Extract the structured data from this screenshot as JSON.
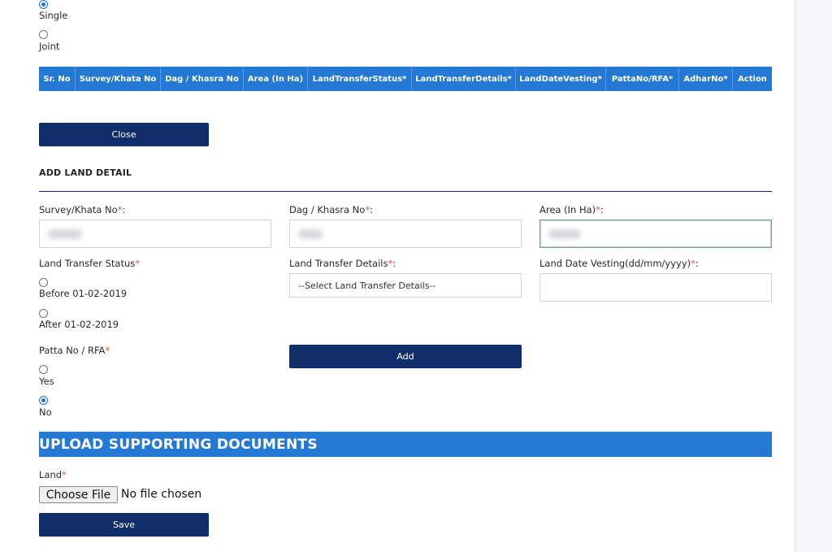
{
  "ownership": {
    "options": [
      {
        "label": "Single",
        "checked": true
      },
      {
        "label": "Joint",
        "checked": false
      }
    ]
  },
  "table": {
    "columns": [
      "Sr. No",
      "Survey/Khata No",
      "Dag / Khasra No",
      "Area (In Ha)",
      "LandTransferStatus*",
      "LandTransferDetails*",
      "LandDateVesting*",
      "PattaNo/RFA*",
      "AdharNo*",
      "Action"
    ]
  },
  "close_button": "Close",
  "add_land_detail": {
    "title": "ADD LAND DETAIL",
    "survey_label": "Survey/Khata No",
    "dag_label": "Dag / Khasra No",
    "area_label": "Area (In Ha)",
    "required_mark": "*",
    "colon": ":",
    "land_transfer_status_label": "Land Transfer Status",
    "land_transfer_status_options": [
      {
        "label": "Before 01-02-2019",
        "checked": false
      },
      {
        "label": "After 01-02-2019",
        "checked": false
      }
    ],
    "land_transfer_details_label": "Land Transfer Details",
    "land_transfer_details_selected": "--Select Land Transfer Details--",
    "land_date_vesting_label": "Land Date Vesting(dd/mm/yyyy)",
    "patta_label": "Patta No / RFA",
    "patta_options": [
      {
        "label": "Yes",
        "checked": false
      },
      {
        "label": "No",
        "checked": true
      }
    ],
    "add_button": "Add"
  },
  "upload": {
    "title": "UPLOAD SUPPORTING DOCUMENTS",
    "land_label": "Land",
    "required_mark": "*",
    "choose_file": "Choose File",
    "no_file": "No file chosen",
    "save_button": "Save"
  },
  "colors": {
    "primary_dark": "#0f2e6a",
    "accent_blue": "#2479d4",
    "required_red": "#d9534f"
  }
}
